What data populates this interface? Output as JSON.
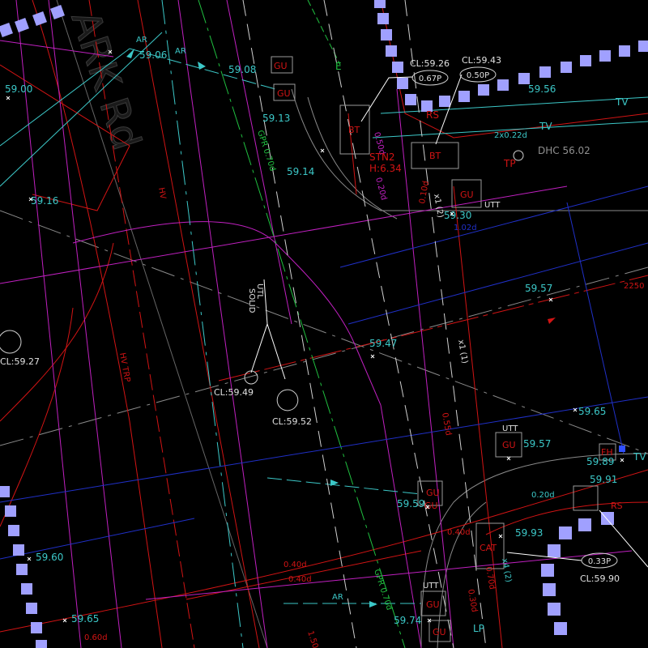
{
  "drawing": {
    "road_name": "ARK Rd",
    "colors": {
      "background": "#000000",
      "cyan": "#3cc8c8",
      "white": "#ffffff",
      "red": "#d21414",
      "magenta": "#c020c0",
      "blue": "#2030c8",
      "green": "#20c040",
      "lavender": "#a0a0ff",
      "grey": "#909090"
    },
    "spot_levels": [
      "59.06",
      "59.08",
      "59.13",
      "59.00",
      "59.14",
      "59.16",
      "59.30",
      "59.56",
      "59.57",
      "59.47",
      "59.65",
      "59.57",
      "59.89",
      "59.91",
      "59.59",
      "59.93",
      "59.60",
      "59.65",
      "59.74"
    ],
    "cover_levels": [
      "CL:59.26",
      "CL:59.43",
      "CL:59.27",
      "CL:59.49",
      "CL:59.52",
      "CL:59.90"
    ],
    "pipe_size_bubbles": [
      "0.67P",
      "0.50P",
      "0.33P"
    ],
    "pit_labels": [
      "GU",
      "GU",
      "BT",
      "BT",
      "GU",
      "GU",
      "GU",
      "GU",
      "CAT",
      "GU",
      "GU",
      "FH",
      "RS"
    ],
    "utility_labels": [
      "UTT",
      "UTT",
      "UTT",
      "TV",
      "TV",
      "TV",
      "TP",
      "DHC 56.02",
      "2x0.22d",
      "0.20d",
      "0.10d",
      "0.40d",
      "0.50d",
      "0.55d",
      "0.70d",
      "0.20d",
      "0.30d",
      "STN2",
      "H:6.34",
      "UTL",
      "SOLID",
      "GPR 0.70d",
      "GPR 0.70d",
      "AR",
      "AR",
      "AR",
      "0.40d",
      "0.40d",
      "x1 (1)",
      "x4 (2)",
      "x1 (2)",
      "2250",
      "1.02d",
      "1.50d",
      "0.60d",
      "RS",
      "E",
      "LP",
      "HV TRP",
      "HV"
    ]
  }
}
